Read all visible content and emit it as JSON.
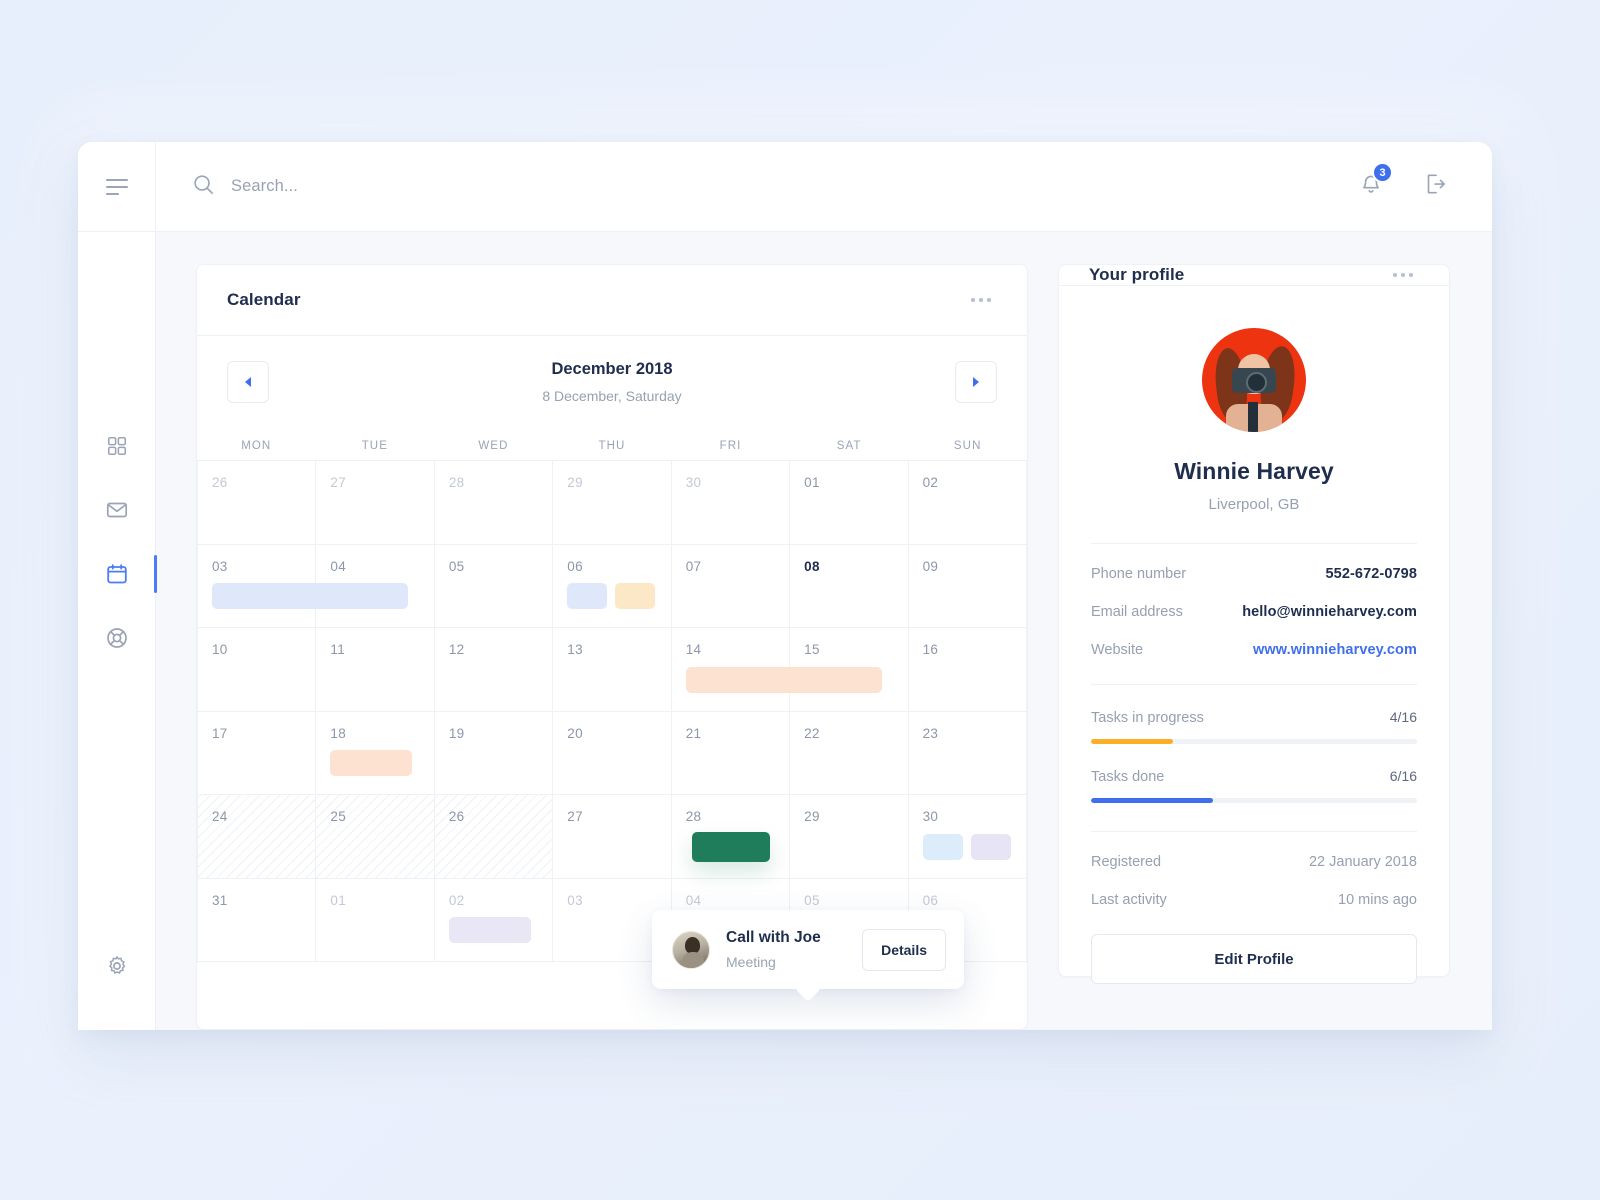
{
  "topbar": {
    "menu_icon": "hamburger-icon",
    "search": {
      "value": "",
      "placeholder": "Search..."
    },
    "notifications": {
      "icon": "bell-icon",
      "count": "3"
    },
    "logout": {
      "icon": "logout-icon"
    }
  },
  "sidebar": {
    "items": [
      {
        "name": "dashboard",
        "icon": "grid-icon",
        "active": false
      },
      {
        "name": "mail",
        "icon": "envelope-icon",
        "active": false
      },
      {
        "name": "calendar",
        "icon": "calendar-icon",
        "active": true
      },
      {
        "name": "support",
        "icon": "lifebuoy-icon",
        "active": false
      }
    ],
    "bottom": {
      "name": "settings",
      "icon": "gear-icon"
    }
  },
  "calendar": {
    "title": "Calendar",
    "month": "December 2018",
    "selected_date": "8 December, Saturday",
    "prev_label": "◀",
    "next_label": "▶",
    "weekdays": [
      "MON",
      "TUE",
      "WED",
      "THU",
      "FRI",
      "SAT",
      "SUN"
    ],
    "days": [
      {
        "n": "26",
        "style": "muted",
        "hatched": false
      },
      {
        "n": "27",
        "style": "muted",
        "hatched": false
      },
      {
        "n": "28",
        "style": "muted",
        "hatched": false
      },
      {
        "n": "29",
        "style": "muted",
        "hatched": false
      },
      {
        "n": "30",
        "style": "muted",
        "hatched": false
      },
      {
        "n": "01",
        "style": "normal",
        "hatched": false
      },
      {
        "n": "02",
        "style": "normal",
        "hatched": false
      },
      {
        "n": "03",
        "style": "normal",
        "hatched": false
      },
      {
        "n": "04",
        "style": "normal",
        "hatched": false
      },
      {
        "n": "05",
        "style": "normal",
        "hatched": false
      },
      {
        "n": "06",
        "style": "normal",
        "hatched": false
      },
      {
        "n": "07",
        "style": "normal",
        "hatched": false
      },
      {
        "n": "08",
        "style": "today",
        "hatched": false
      },
      {
        "n": "09",
        "style": "normal",
        "hatched": false
      },
      {
        "n": "10",
        "style": "normal",
        "hatched": false
      },
      {
        "n": "11",
        "style": "normal",
        "hatched": false
      },
      {
        "n": "12",
        "style": "normal",
        "hatched": false
      },
      {
        "n": "13",
        "style": "normal",
        "hatched": false
      },
      {
        "n": "14",
        "style": "normal",
        "hatched": false
      },
      {
        "n": "15",
        "style": "normal",
        "hatched": false
      },
      {
        "n": "16",
        "style": "normal",
        "hatched": false
      },
      {
        "n": "17",
        "style": "normal",
        "hatched": false
      },
      {
        "n": "18",
        "style": "normal",
        "hatched": false
      },
      {
        "n": "19",
        "style": "normal",
        "hatched": false
      },
      {
        "n": "20",
        "style": "normal",
        "hatched": false
      },
      {
        "n": "21",
        "style": "normal",
        "hatched": false
      },
      {
        "n": "22",
        "style": "normal",
        "hatched": false
      },
      {
        "n": "23",
        "style": "normal",
        "hatched": false
      },
      {
        "n": "24",
        "style": "normal",
        "hatched": true
      },
      {
        "n": "25",
        "style": "normal",
        "hatched": true
      },
      {
        "n": "26",
        "style": "normal",
        "hatched": true
      },
      {
        "n": "27",
        "style": "normal",
        "hatched": false
      },
      {
        "n": "28",
        "style": "normal",
        "hatched": false
      },
      {
        "n": "29",
        "style": "normal",
        "hatched": false
      },
      {
        "n": "30",
        "style": "normal",
        "hatched": false
      },
      {
        "n": "31",
        "style": "normal",
        "hatched": false
      },
      {
        "n": "01",
        "style": "muted",
        "hatched": false
      },
      {
        "n": "02",
        "style": "muted",
        "hatched": false
      },
      {
        "n": "03",
        "style": "muted",
        "hatched": false
      },
      {
        "n": "04",
        "style": "muted",
        "hatched": false
      },
      {
        "n": "05",
        "style": "muted",
        "hatched": false
      },
      {
        "n": "06",
        "style": "muted",
        "hatched": false
      }
    ],
    "events": [
      {
        "id": "ev-blue-span",
        "cell": 7,
        "size": "span2",
        "color": "#dfe8fb"
      },
      {
        "id": "ev-blue-small",
        "cell": 10,
        "size": "small",
        "color": "#dfe8fb"
      },
      {
        "id": "ev-orange-small",
        "cell": 10,
        "size": "small2",
        "color": "#fce7c7"
      },
      {
        "id": "ev-peach-span",
        "cell": 18,
        "size": "span2",
        "color": "#fde2d2"
      },
      {
        "id": "ev-peach-small",
        "cell": 22,
        "size": "med",
        "color": "#fde2d2"
      },
      {
        "id": "ev-green",
        "cell": 32,
        "size": "green",
        "color": "#1f7d5c"
      },
      {
        "id": "ev-blue-chip",
        "cell": 34,
        "size": "small",
        "color": "#dcecfb"
      },
      {
        "id": "ev-purple-chip",
        "cell": 34,
        "size": "small2",
        "color": "#e7e4f5"
      },
      {
        "id": "ev-purple-bottom",
        "cell": 37,
        "size": "med",
        "color": "#e9e6f6"
      }
    ],
    "popover": {
      "title": "Call with Joe",
      "subtitle": "Meeting",
      "button": "Details",
      "avatar": "person-avatar"
    }
  },
  "profile": {
    "title": "Your profile",
    "avatar": "user-photo-camera",
    "name": "Winnie Harvey",
    "location": "Liverpool, GB",
    "details": [
      {
        "label": "Phone number",
        "value": "552-672-0798",
        "link": false
      },
      {
        "label": "Email address",
        "value": "hello@winnieharvey.com",
        "link": false
      },
      {
        "label": "Website",
        "value": "www.winnieharvey.com",
        "link": true
      }
    ],
    "tasks": [
      {
        "label": "Tasks in progress",
        "count": "4/16",
        "percent": 25,
        "color": "#fbaf28"
      },
      {
        "label": "Tasks done",
        "count": "6/16",
        "percent": 37.5,
        "color": "#3f6fec"
      }
    ],
    "meta": [
      {
        "label": "Registered",
        "value": "22 January 2018"
      },
      {
        "label": "Last activity",
        "value": "10 mins ago"
      }
    ],
    "edit_button": "Edit Profile"
  }
}
